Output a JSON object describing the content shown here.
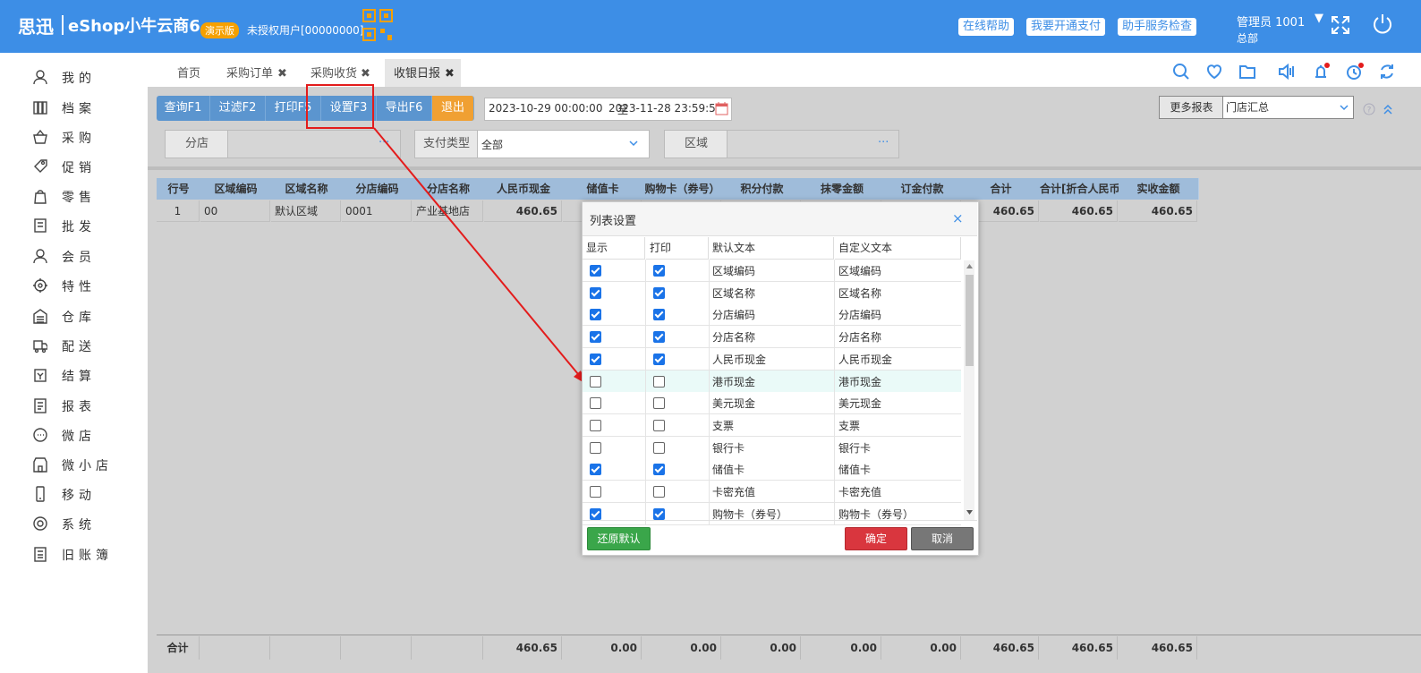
{
  "header": {
    "logo_brand": "思迅",
    "logo_product": "eShop小牛云商6",
    "demo_badge": "演示版",
    "license_text": "未授权用户[00000000]",
    "buttons": [
      "在线帮助",
      "我要开通支付",
      "助手服务检查"
    ],
    "user_name": "管理员 1001",
    "user_caret": "▼",
    "org": "总部"
  },
  "sidebar": {
    "items": [
      {
        "label": "我的",
        "icon": "user-icon"
      },
      {
        "label": "档案",
        "icon": "archive-icon"
      },
      {
        "label": "采购",
        "icon": "basket-icon"
      },
      {
        "label": "促销",
        "icon": "tag-icon"
      },
      {
        "label": "零售",
        "icon": "bag-icon"
      },
      {
        "label": "批发",
        "icon": "wholesale-icon"
      },
      {
        "label": "会员",
        "icon": "member-icon"
      },
      {
        "label": "特性",
        "icon": "target-icon"
      },
      {
        "label": "仓库",
        "icon": "warehouse-icon"
      },
      {
        "label": "配送",
        "icon": "truck-icon"
      },
      {
        "label": "结算",
        "icon": "settle-icon"
      },
      {
        "label": "报表",
        "icon": "report-icon"
      },
      {
        "label": "微店",
        "icon": "chat-icon"
      },
      {
        "label": "微小店",
        "icon": "shop-icon"
      },
      {
        "label": "移动",
        "icon": "mobile-icon"
      },
      {
        "label": "系统",
        "icon": "gear-icon"
      },
      {
        "label": "旧账簿",
        "icon": "ledger-icon"
      }
    ]
  },
  "tabs": [
    {
      "label": "首页",
      "closable": false
    },
    {
      "label": "采购订单",
      "closable": true
    },
    {
      "label": "采购收货",
      "closable": true
    },
    {
      "label": "收银日报",
      "closable": true,
      "active": true
    }
  ],
  "close_glyph": "✖",
  "toolbar": {
    "buttons": [
      "查询F1",
      "过滤F2",
      "打印F5",
      "设置F3",
      "导出F6",
      "退出"
    ],
    "date_from": "2023-10-29 00:00:00",
    "date_sep": "至",
    "date_to": "2023-11-28 23:59:59",
    "more_reports_label": "更多报表",
    "report_select_value": "门店汇总"
  },
  "filters": {
    "branch_label": "分店",
    "pay_type_label": "支付类型",
    "pay_type_value": "全部",
    "region_label": "区域",
    "ellipsis": "···"
  },
  "table": {
    "headers": [
      "行号",
      "区域编码",
      "区域名称",
      "分店编码",
      "分店名称",
      "人民币现金",
      "储值卡",
      "购物卡（券号）",
      "积分付款",
      "抹零金额",
      "订金付款",
      "合计",
      "合计[折合人民币",
      "实收金额"
    ],
    "rows": [
      [
        "1",
        "00",
        "默认区域",
        "0001",
        "产业基地店",
        "460.65",
        "",
        "",
        "",
        "",
        "",
        "460.65",
        "460.65",
        "460.65"
      ]
    ],
    "footer": [
      "合计",
      "",
      "",
      "",
      "",
      "460.65",
      "0.00",
      "0.00",
      "0.00",
      "0.00",
      "0.00",
      "460.65",
      "460.65",
      "460.65"
    ]
  },
  "modal": {
    "title": "列表设置",
    "close": "×",
    "columns": [
      "显示",
      "打印",
      "默认文本",
      "自定义文本"
    ],
    "rows": [
      {
        "show": true,
        "print": true,
        "default": "区域编码",
        "custom": "区域编码"
      },
      {
        "show": true,
        "print": true,
        "default": "区域名称",
        "custom": "区域名称"
      },
      {
        "show": true,
        "print": true,
        "default": "分店编码",
        "custom": "分店编码"
      },
      {
        "show": true,
        "print": true,
        "default": "分店名称",
        "custom": "分店名称"
      },
      {
        "show": true,
        "print": true,
        "default": "人民币现金",
        "custom": "人民币现金"
      },
      {
        "show": false,
        "print": false,
        "default": "港币现金",
        "custom": "港币现金",
        "highlight": true
      },
      {
        "show": false,
        "print": false,
        "default": "美元现金",
        "custom": "美元现金"
      },
      {
        "show": false,
        "print": false,
        "default": "支票",
        "custom": "支票"
      },
      {
        "show": false,
        "print": false,
        "default": "银行卡",
        "custom": "银行卡"
      },
      {
        "show": true,
        "print": true,
        "default": "储值卡",
        "custom": "储值卡"
      },
      {
        "show": false,
        "print": false,
        "default": "卡密充值",
        "custom": "卡密充值"
      },
      {
        "show": true,
        "print": true,
        "default": "购物卡（券号）",
        "custom": "购物卡（券号）"
      }
    ],
    "restore_label": "还原默认",
    "ok_label": "确定",
    "cancel_label": "取消"
  },
  "colors": {
    "header_blue": "#3d8ee6",
    "annotation_red": "#e31c1c",
    "ok_red": "#d9363e",
    "restore_green": "#3aa64a"
  }
}
